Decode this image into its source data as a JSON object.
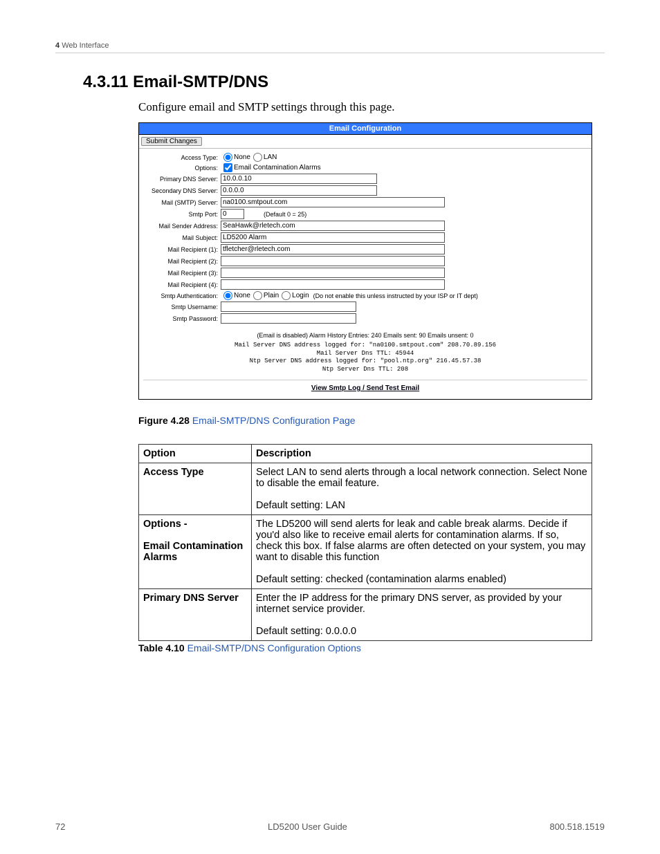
{
  "header": {
    "chapnum": "4",
    "chaptitle": "Web Interface"
  },
  "section": {
    "number": "4.3.11",
    "title": "Email-SMTP/DNS"
  },
  "intro": "Configure email and SMTP settings through this page.",
  "config": {
    "panel_title": "Email Configuration",
    "submit_label": "Submit Changes",
    "rows": {
      "access_type": {
        "label": "Access Type:",
        "opt_none": "None",
        "opt_lan": "LAN"
      },
      "options": {
        "label": "Options:",
        "checkbox_label": "Email Contamination Alarms"
      },
      "primary_dns": {
        "label": "Primary DNS Server:",
        "value": "10.0.0.10"
      },
      "secondary_dns": {
        "label": "Secondary DNS Server:",
        "value": "0.0.0.0"
      },
      "smtp_server": {
        "label": "Mail (SMTP) Server:",
        "value": "na0100.smtpout.com"
      },
      "smtp_port": {
        "label": "Smtp Port:",
        "value": "0",
        "hint": "(Default 0 = 25)"
      },
      "sender": {
        "label": "Mail Sender Address:",
        "value": "SeaHawk@rletech.com"
      },
      "subject": {
        "label": "Mail Subject:",
        "value": "LD5200 Alarm"
      },
      "r1": {
        "label": "Mail Recipient (1):",
        "value": "tfletcher@rletech.com"
      },
      "r2": {
        "label": "Mail Recipient (2):",
        "value": ""
      },
      "r3": {
        "label": "Mail Recipient (3):",
        "value": ""
      },
      "r4": {
        "label": "Mail Recipient (4):",
        "value": ""
      },
      "auth": {
        "label": "Smtp Authentication:",
        "opt_none": "None",
        "opt_plain": "Plain",
        "opt_login": "Login",
        "hint": "(Do not enable this unless instructed by your ISP or IT dept)"
      },
      "user": {
        "label": "Smtp Username:",
        "value": ""
      },
      "pass": {
        "label": "Smtp Password:",
        "value": ""
      }
    },
    "status_line": "(Email is disabled) Alarm History Entries: 240 Emails sent: 90 Emails unsent: 0",
    "mono": "Mail Server DNS address logged for: \"na0100.smtpout.com\" 208.70.89.156\nMail Server Dns TTL: 45944\nNtp Server DNS address logged for: \"pool.ntp.org\" 216.45.57.38\nNtp Server Dns TTL: 208",
    "link_label": "View Smtp Log / Send Test Email"
  },
  "figure": {
    "prefix": "Figure 4.28",
    "title": "Email-SMTP/DNS Configuration Page"
  },
  "table": {
    "head_option": "Option",
    "head_desc": "Description",
    "rows": [
      {
        "option": "Access Type",
        "desc": "Select LAN to send alerts through a local network connection. Select None to disable the email feature.",
        "default": "Default setting: LAN"
      },
      {
        "option": "Options -\n\nEmail Contamination Alarms",
        "desc": "The LD5200 will send alerts for leak and cable break alarms. Decide if you'd also like to receive email alerts for contamination alarms. If so, check this box. If false alarms are often detected on your system, you may want to disable this function",
        "default": "Default setting: checked (contamination alarms enabled)"
      },
      {
        "option": "Primary DNS Server",
        "desc": "Enter the IP address for the primary DNS server, as provided by your internet service provider.",
        "default": "Default setting: 0.0.0.0"
      }
    ]
  },
  "table_caption": {
    "prefix": "Table 4.10",
    "title": "Email-SMTP/DNS Configuration Options"
  },
  "footer": {
    "pagenum": "72",
    "doctitle": "LD5200 User Guide",
    "phone": "800.518.1519"
  }
}
